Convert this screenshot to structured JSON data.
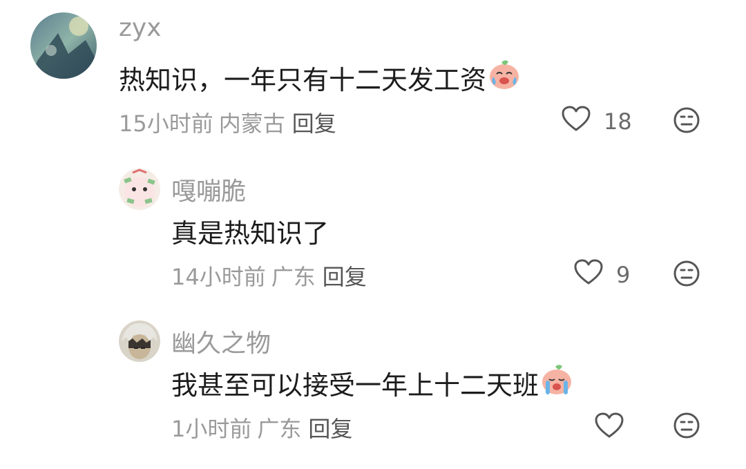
{
  "comments": [
    {
      "username": "zyx",
      "text": "热知识，一年只有十二天发工资",
      "emoji": "crying-laughing-peach-emoji",
      "time": "15小时前",
      "location": "内蒙古",
      "reply_label": "回复",
      "likes": "18"
    },
    {
      "username": "嘎嘣脆",
      "text": "真是热知识了",
      "time": "14小时前",
      "location": "广东",
      "reply_label": "回复",
      "likes": "9"
    },
    {
      "username": "幽久之物",
      "text": "我甚至可以接受一年上十二天班",
      "emoji": "sobbing-peach-emoji",
      "time": "1小时前",
      "location": "广东",
      "reply_label": "回复",
      "likes": ""
    }
  ],
  "colors": {
    "username": "#9a9a9a",
    "content": "#1c1c1c",
    "meta": "#9a9a9a",
    "icon": "#555555",
    "background": "#ffffff"
  },
  "icons": {
    "like": "heart-outline-icon",
    "dislike": "meh-face-icon"
  }
}
